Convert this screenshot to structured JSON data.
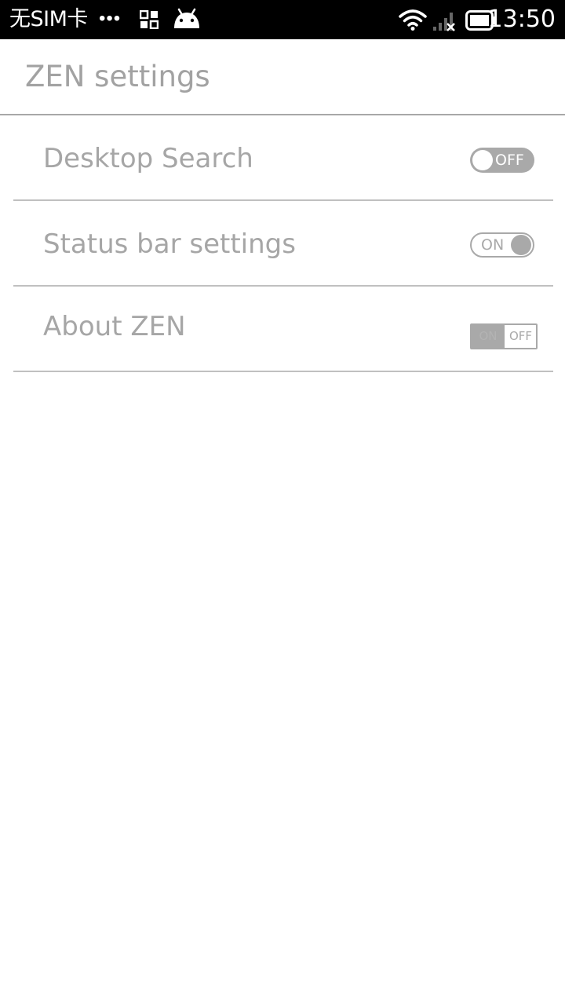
{
  "status_bar": {
    "carrier": "无SIM卡",
    "dots": "•••",
    "time": "13:50",
    "icons": [
      "apps-grid-icon",
      "android-icon",
      "wifi-icon",
      "no-signal-icon",
      "battery-icon"
    ]
  },
  "app": {
    "title": "ZEN settings"
  },
  "settings": {
    "items": [
      {
        "label": "Desktop Search",
        "toggle_text": "OFF",
        "state": "off"
      },
      {
        "label": "Status bar settings",
        "toggle_text": "ON",
        "state": "on"
      },
      {
        "label": "About ZEN",
        "toggle_text": "OFF",
        "ghost_text": "ON",
        "state": "off"
      }
    ]
  },
  "colors": {
    "status_bar_bg": "#000000",
    "text_gray": "#a6a6a6",
    "toggle_gray": "#a9a9a9",
    "divider": "#c0c0c0"
  }
}
